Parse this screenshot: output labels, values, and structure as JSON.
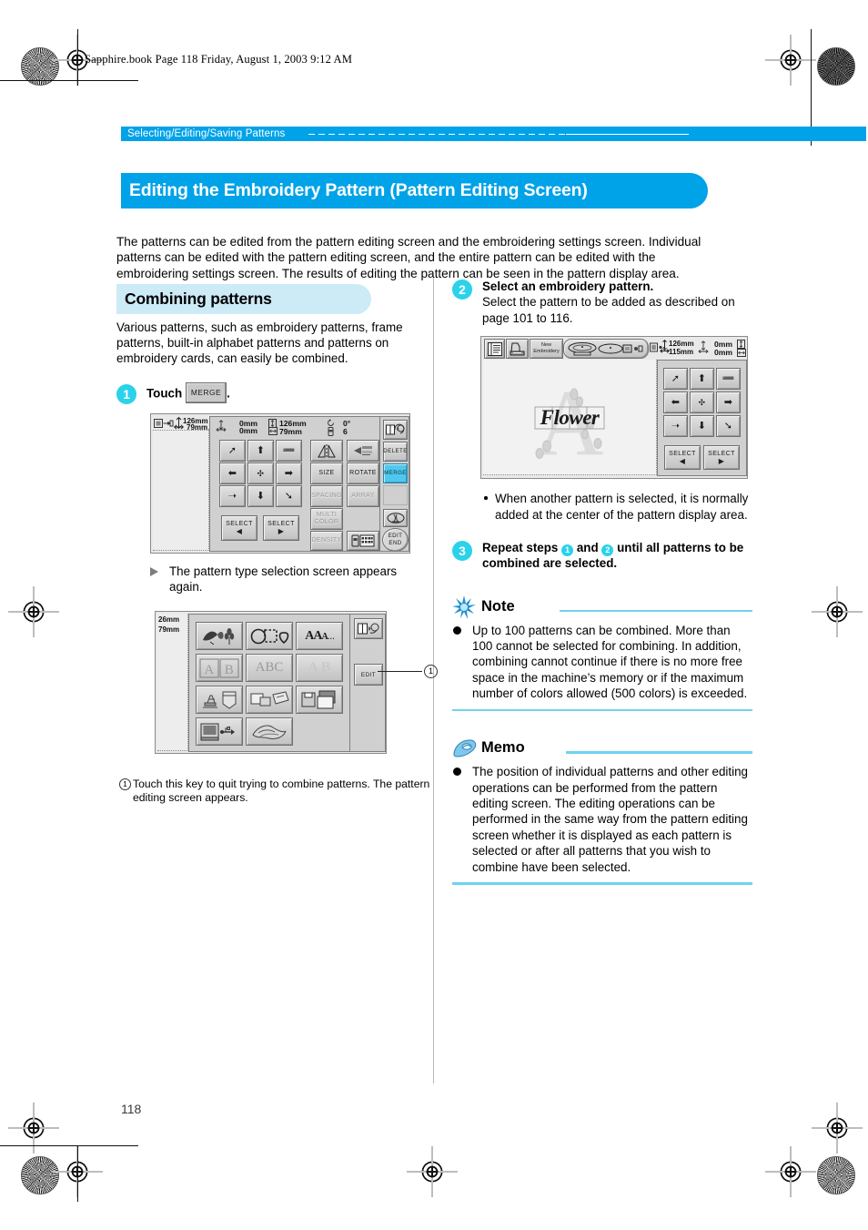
{
  "page": {
    "file_meta": "Sapphire.book  Page 118  Friday, August 1, 2003  9:12 AM",
    "page_number": "118",
    "running_head": "Selecting/Editing/Saving Patterns",
    "chapter_title": "Editing the Embroidery Pattern (Pattern Editing Screen)",
    "intro": "The patterns can be edited from the pattern editing screen and the embroidering settings screen. Individual patterns can be edited with the pattern editing screen, and the entire pattern can be edited with the embroidering settings screen. The results of editing the pattern can be seen in the pattern display area."
  },
  "left_column": {
    "section_title": "Combining patterns",
    "section_body": "Various patterns, such as embroidery patterns, frame patterns, built-in alphabet patterns and patterns on embroidery cards, can easily be combined.",
    "step1": {
      "number": "1",
      "text_before": "Touch",
      "key_label": "MERGE",
      "text_after": "."
    },
    "result1": "The pattern type selection screen appears again.",
    "caption1": {
      "marker": "1",
      "text": "Touch this key to quit trying to combine patterns. The pattern editing screen appears."
    }
  },
  "right_column": {
    "step2": {
      "number": "2",
      "title": "Select an embroidery pattern.",
      "text": "Select the pattern to be added as described on page 101 to 116."
    },
    "bullet2": "When another pattern is selected, it is normally added at the center of the pattern display area.",
    "step3": {
      "number": "3",
      "part1": "Repeat steps",
      "inline1": "1",
      "part2": "and",
      "inline2": "2",
      "part3": "until all patterns to be combined are selected."
    },
    "note": {
      "title": "Note",
      "items": [
        "Up to 100 patterns can be combined. More than 100 cannot be selected for combining. In addition, combining cannot continue if there is no more free space in the machine’s memory or if the maximum number of colors allowed (500 colors) is exceeded."
      ]
    },
    "memo": {
      "title": "Memo",
      "items": [
        "The position of individual patterns and other editing operations can be performed from the pattern editing screen. The editing operations can be performed in the same way from the pattern editing screen whether it is displayed as each pattern is selected or after all patterns that you wish to combine have been selected."
      ]
    }
  },
  "screen_editing": {
    "name": "pattern-editing-screen",
    "size_height": "126mm",
    "size_width": "79mm",
    "pos_vertical": "0mm",
    "pos_horizontal": "0mm",
    "dim_height": "126mm",
    "dim_width": "79mm",
    "rotation": "0°",
    "color_count": "6",
    "arrow_keys": [
      "↖",
      "↑",
      "↗",
      "←",
      "✥",
      "→",
      "↙",
      "↓",
      "↘"
    ],
    "select_prev": "SELECT",
    "select_next": "SELECT",
    "edit_keys": [
      {
        "label": "MIRROR",
        "glyph": "mirror-icon",
        "dim": false
      },
      {
        "label": "ROTATE-ICON",
        "glyph": "flip-icon",
        "dim": false
      },
      {
        "label": "SIZE",
        "dim": false
      },
      {
        "label": "ROTATE",
        "dim": false
      },
      {
        "label": "SPACING",
        "dim": true
      },
      {
        "label": "ARRAY",
        "dim": true
      },
      {
        "label": "MULTI COLOR",
        "dim": true
      },
      {
        "label": "DENSITY",
        "dim": true
      }
    ],
    "side_keys": [
      {
        "label": "",
        "glyph": "manual-icon",
        "state": "normal"
      },
      {
        "label": "DELETE",
        "state": "normal"
      },
      {
        "label": "MERGE",
        "state": "selected"
      },
      {
        "label": "",
        "state": "blank"
      },
      {
        "label": "",
        "glyph": "needle-icon",
        "state": "normal"
      },
      {
        "label": "EDIT END",
        "state": "round"
      }
    ]
  },
  "screen_selection": {
    "name": "pattern-type-selection-screen",
    "size_height": "26mm",
    "size_width": "79mm",
    "tiles": [
      "embroidery-patterns-icon",
      "frame-patterns-icon",
      "alphabet-patterns-icon",
      "decorative-alphabet-icon",
      "script-alphabet-icon",
      "outline-alphabet-icon",
      "monogram-icon",
      "embroidery-cards-icon",
      "memory-save-icon",
      "usb-computer-icon",
      "floral-alphabet-icon"
    ],
    "side_keys": [
      {
        "label": "",
        "glyph": "manual-icon"
      },
      {
        "label": "EDIT"
      }
    ],
    "callout": "1"
  },
  "screen_flower": {
    "name": "embroidery-pattern-selected-screen",
    "toolbar": [
      "settings-icon",
      "presser-foot-icon",
      "New Embroidery",
      "hoop-select-icon"
    ],
    "size_height": "126mm",
    "size_width": "115mm",
    "pos_vertical": "0mm",
    "pos_horizontal": "0mm",
    "dim_height": "0mm",
    "dim_width": "0mm",
    "pattern_text": "Flower",
    "arrow_keys": [
      "↖",
      "↑",
      "↗",
      "←",
      "✥",
      "→",
      "↙",
      "↓",
      "↘"
    ],
    "select_prev": "SELECT",
    "select_next": "SELECT"
  }
}
